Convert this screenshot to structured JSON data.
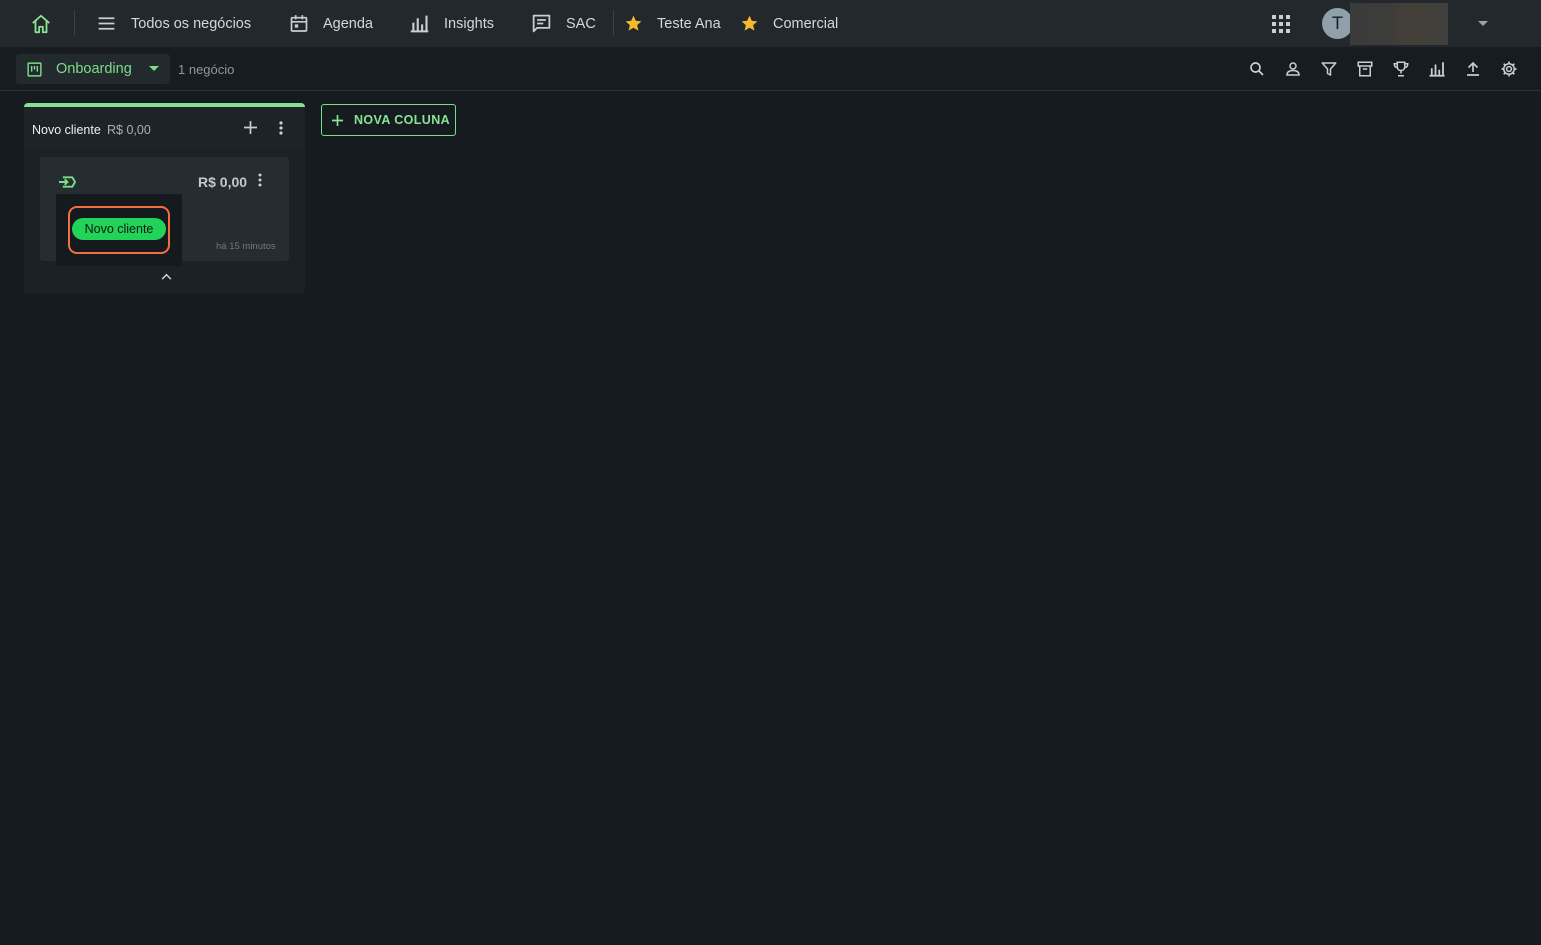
{
  "nav": {
    "items": [
      {
        "label": "Todos os negócios",
        "icon": "list-icon"
      },
      {
        "label": "Agenda",
        "icon": "calendar-icon"
      },
      {
        "label": "Insights",
        "icon": "bar-chart-icon"
      },
      {
        "label": "SAC",
        "icon": "chat-icon"
      },
      {
        "label": "Teste Ana",
        "icon": "star-icon"
      },
      {
        "label": "Comercial",
        "icon": "star-icon"
      }
    ],
    "avatar_initial": "T"
  },
  "toolbar": {
    "pipeline": "Onboarding",
    "deal_count": "1 negócio"
  },
  "board": {
    "columns": [
      {
        "title": "Novo cliente",
        "total": "R$ 0,00",
        "cards": [
          {
            "value": "R$ 0,00",
            "tag": "Novo cliente",
            "time": "há 15 minutos"
          }
        ]
      }
    ],
    "new_column_label": "NOVA COLUNA"
  },
  "colors": {
    "accent": "#7ddc8a",
    "tag_green": "#22d35a",
    "highlight": "#f0703f",
    "star": "#f5b82e",
    "background": "#151b1e"
  }
}
